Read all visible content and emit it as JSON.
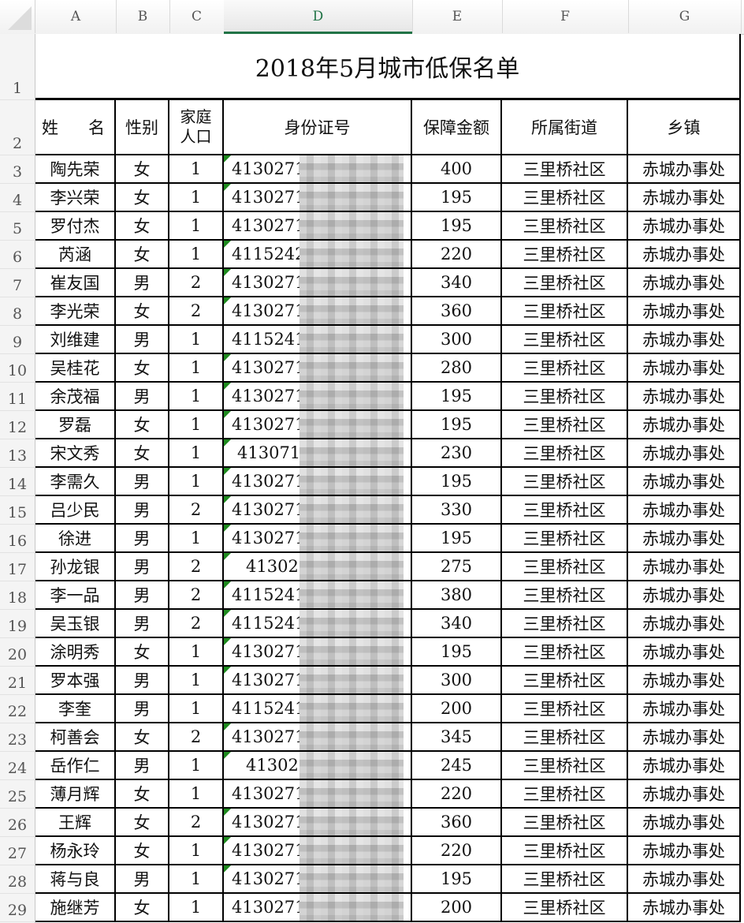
{
  "sheet": {
    "columns": [
      "A",
      "B",
      "C",
      "D",
      "E",
      "F",
      "G"
    ],
    "active_column": "D",
    "row_numbers": [
      "1",
      "2",
      "3",
      "4",
      "5",
      "6",
      "7",
      "8",
      "9",
      "10",
      "11",
      "12",
      "13",
      "14",
      "15",
      "16",
      "17",
      "18",
      "19",
      "20",
      "21",
      "22",
      "23",
      "24",
      "25",
      "26",
      "27",
      "28",
      "29"
    ]
  },
  "title": "2018年5月城市低保名单",
  "headers": {
    "name_left": "姓",
    "name_right": "名",
    "gender": "性别",
    "household_line1": "家庭",
    "household_line2": "人口",
    "id_number": "身份证号",
    "amount": "保障金额",
    "street": "所属街道",
    "town": "乡镇"
  },
  "rows": [
    {
      "name": "陶先荣",
      "gender": "女",
      "household": "1",
      "id_prefix": "41302719",
      "id_style": "normal",
      "flag": true,
      "amount": "400",
      "street": "三里桥社区",
      "town": "赤城办事处"
    },
    {
      "name": "李兴荣",
      "gender": "女",
      "household": "1",
      "id_prefix": "41302719",
      "id_style": "normal",
      "flag": true,
      "amount": "195",
      "street": "三里桥社区",
      "town": "赤城办事处"
    },
    {
      "name": "罗付杰",
      "gender": "女",
      "household": "1",
      "id_prefix": "41302719",
      "id_style": "normal",
      "flag": false,
      "amount": "195",
      "street": "三里桥社区",
      "town": "赤城办事处"
    },
    {
      "name": "芮涵",
      "gender": "女",
      "household": "1",
      "id_prefix": "41152420",
      "id_style": "normal",
      "flag": true,
      "amount": "220",
      "street": "三里桥社区",
      "town": "赤城办事处"
    },
    {
      "name": "崔友国",
      "gender": "男",
      "household": "2",
      "id_prefix": "41302719",
      "id_style": "normal",
      "flag": true,
      "amount": "340",
      "street": "三里桥社区",
      "town": "赤城办事处"
    },
    {
      "name": "李光荣",
      "gender": "女",
      "household": "2",
      "id_prefix": "41302719",
      "id_style": "normal",
      "flag": true,
      "amount": "360",
      "street": "三里桥社区",
      "town": "赤城办事处"
    },
    {
      "name": "刘维建",
      "gender": "男",
      "household": "1",
      "id_prefix": "41152419",
      "id_style": "normal",
      "flag": false,
      "amount": "300",
      "street": "三里桥社区",
      "town": "赤城办事处"
    },
    {
      "name": "吴桂花",
      "gender": "女",
      "household": "1",
      "id_prefix": "41302719",
      "id_style": "normal",
      "flag": true,
      "amount": "280",
      "street": "三里桥社区",
      "town": "赤城办事处"
    },
    {
      "name": "余茂福",
      "gender": "男",
      "household": "1",
      "id_prefix": "41302719",
      "id_style": "normal",
      "flag": true,
      "amount": "195",
      "street": "三里桥社区",
      "town": "赤城办事处"
    },
    {
      "name": "罗磊",
      "gender": "女",
      "household": "1",
      "id_prefix": "41302719",
      "id_style": "normal",
      "flag": true,
      "amount": "195",
      "street": "三里桥社区",
      "town": "赤城办事处"
    },
    {
      "name": "宋文秀",
      "gender": "女",
      "household": "1",
      "id_prefix": "4130719",
      "id_style": "mid",
      "flag": true,
      "amount": "230",
      "street": "三里桥社区",
      "town": "赤城办事处"
    },
    {
      "name": "李需久",
      "gender": "男",
      "household": "1",
      "id_prefix": "41302719",
      "id_style": "normal",
      "flag": true,
      "amount": "195",
      "street": "三里桥社区",
      "town": "赤城办事处"
    },
    {
      "name": "吕少民",
      "gender": "男",
      "household": "2",
      "id_prefix": "41302719",
      "id_style": "normal",
      "flag": true,
      "amount": "330",
      "street": "三里桥社区",
      "town": "赤城办事处"
    },
    {
      "name": "徐进",
      "gender": "男",
      "household": "1",
      "id_prefix": "41302719",
      "id_style": "normal",
      "flag": true,
      "amount": "195",
      "street": "三里桥社区",
      "town": "赤城办事处"
    },
    {
      "name": "孙龙银",
      "gender": "男",
      "household": "2",
      "id_prefix": "413027",
      "id_style": "short",
      "flag": true,
      "amount": "275",
      "street": "三里桥社区",
      "town": "赤城办事处"
    },
    {
      "name": "李一品",
      "gender": "男",
      "household": "2",
      "id_prefix": "41152419",
      "id_style": "normal",
      "flag": true,
      "amount": "380",
      "street": "三里桥社区",
      "town": "赤城办事处"
    },
    {
      "name": "吴玉银",
      "gender": "男",
      "household": "2",
      "id_prefix": "41152419",
      "id_style": "normal",
      "flag": true,
      "amount": "340",
      "street": "三里桥社区",
      "town": "赤城办事处"
    },
    {
      "name": "涂明秀",
      "gender": "女",
      "household": "1",
      "id_prefix": "41302719",
      "id_style": "normal",
      "flag": true,
      "amount": "195",
      "street": "三里桥社区",
      "town": "赤城办事处"
    },
    {
      "name": "罗本强",
      "gender": "男",
      "household": "1",
      "id_prefix": "41302719",
      "id_style": "normal",
      "flag": true,
      "amount": "300",
      "street": "三里桥社区",
      "town": "赤城办事处"
    },
    {
      "name": "李奎",
      "gender": "男",
      "household": "1",
      "id_prefix": "41152419",
      "id_style": "normal",
      "flag": false,
      "amount": "200",
      "street": "三里桥社区",
      "town": "赤城办事处"
    },
    {
      "name": "柯善会",
      "gender": "女",
      "household": "2",
      "id_prefix": "41302719",
      "id_style": "normal",
      "flag": true,
      "amount": "345",
      "street": "三里桥社区",
      "town": "赤城办事处"
    },
    {
      "name": "岳作仁",
      "gender": "男",
      "household": "1",
      "id_prefix": "413027",
      "id_style": "short",
      "flag": true,
      "amount": "245",
      "street": "三里桥社区",
      "town": "赤城办事处"
    },
    {
      "name": "薄月辉",
      "gender": "女",
      "household": "1",
      "id_prefix": "41302719",
      "id_style": "normal",
      "flag": false,
      "amount": "220",
      "street": "三里桥社区",
      "town": "赤城办事处"
    },
    {
      "name": "王辉",
      "gender": "女",
      "household": "2",
      "id_prefix": "41302719",
      "id_style": "normal",
      "flag": true,
      "amount": "360",
      "street": "三里桥社区",
      "town": "赤城办事处"
    },
    {
      "name": "杨永玲",
      "gender": "女",
      "household": "1",
      "id_prefix": "41302719",
      "id_style": "normal",
      "flag": true,
      "amount": "220",
      "street": "三里桥社区",
      "town": "赤城办事处"
    },
    {
      "name": "蒋与良",
      "gender": "男",
      "household": "1",
      "id_prefix": "41302719",
      "id_style": "normal",
      "flag": true,
      "amount": "195",
      "street": "三里桥社区",
      "town": "赤城办事处"
    },
    {
      "name": "施继芳",
      "gender": "女",
      "household": "1",
      "id_prefix": "41302719",
      "id_style": "normal",
      "flag": false,
      "amount": "200",
      "street": "三里桥社区",
      "town": "赤城办事处"
    }
  ],
  "colors": {
    "active_column_accent": "#217346",
    "number_stored_as_text_flag": "#1e8a1e"
  }
}
